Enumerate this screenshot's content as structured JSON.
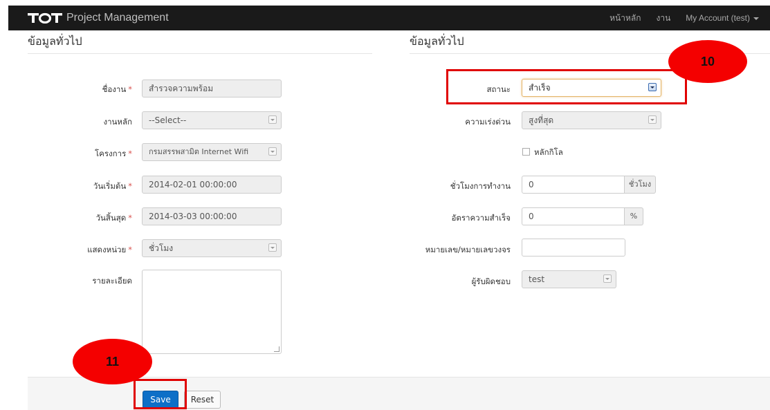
{
  "navbar": {
    "brand": "Project Management",
    "logo_text": "TOT",
    "links": [
      "หน้าหลัก",
      "งาน",
      "My Account (test)"
    ]
  },
  "left": {
    "section_title": "ข้อมูลทั่วไป",
    "job_name": {
      "label": "ชื่องาน",
      "value": "สำรวจความพร้อม",
      "required": "*"
    },
    "main_job": {
      "label": "งานหลัก",
      "value": "--Select--"
    },
    "project": {
      "label": "โครงการ",
      "value": "กรมสรรพสามิต Internet Wifi",
      "required": "*"
    },
    "start_date": {
      "label": "วันเริ่มต้น",
      "value": "2014-02-01 00:00:00",
      "required": "*"
    },
    "end_date": {
      "label": "วันสิ้นสุด",
      "value": "2014-03-03 00:00:00",
      "required": "*"
    },
    "display_unit": {
      "label": "แสดงหน่วย",
      "value": "ชั่วโมง",
      "required": "*"
    },
    "details": {
      "label": "รายละเอียด",
      "value": ""
    }
  },
  "right": {
    "section_title": "ข้อมูลทั่วไป",
    "status": {
      "label": "สถานะ",
      "value": "สำเร็จ"
    },
    "priority": {
      "label": "ความเร่งด่วน",
      "value": "สูงที่สุด"
    },
    "kilometer": {
      "label": "หลักกิโล"
    },
    "work_hours": {
      "label": "ชั่วโมงการทำงาน",
      "value": "0",
      "unit": "ชั่วโมง"
    },
    "success_rate": {
      "label": "อัตราความสำเร็จ",
      "value": "0",
      "unit": "%"
    },
    "circuit_number": {
      "label": "หมายเลข/หมายเลขวงจร",
      "value": ""
    },
    "assignee": {
      "label": "ผู้รับผิดชอบ",
      "value": "test"
    }
  },
  "footer": {
    "save_label": "Save",
    "reset_label": "Reset"
  },
  "annotations": {
    "callout_10": "10",
    "callout_11": "11",
    "highlight_color": "#e00000"
  }
}
